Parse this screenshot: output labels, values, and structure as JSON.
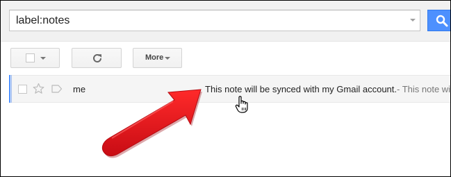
{
  "search": {
    "query": "label:notes"
  },
  "toolbar": {
    "more_label": "More"
  },
  "message_list": {
    "rows": [
      {
        "sender": "me",
        "subject": "This note will be synced with my Gmail account.",
        "snippet": "- This note wi"
      }
    ]
  },
  "colors": {
    "search_button": "#4d90fe",
    "annotation_arrow": "#e8101a",
    "row_accent": "#4d90fe"
  },
  "icons": {
    "search": "search-icon",
    "refresh": "refresh-icon",
    "star": "star-icon",
    "label": "label-icon",
    "cursor": "hand-cursor-icon",
    "arrow": "annotation-arrow"
  }
}
